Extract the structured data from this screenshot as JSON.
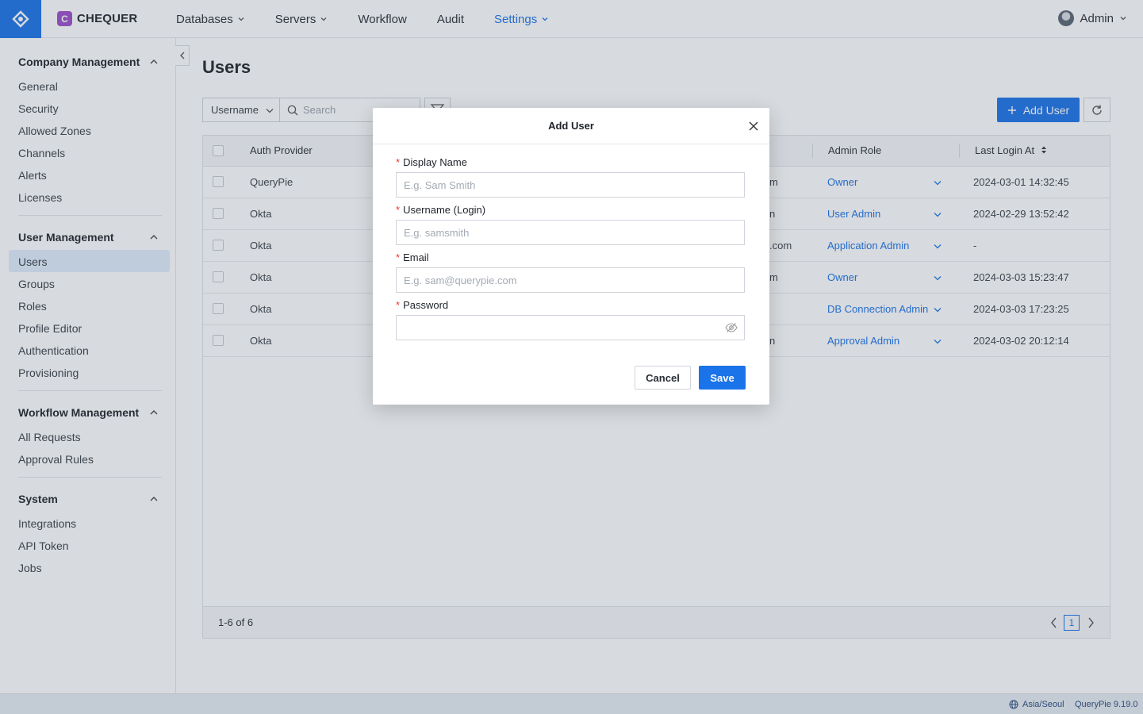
{
  "brand": {
    "name": "CHEQUER",
    "letter": "C"
  },
  "nav": [
    {
      "label": "Databases",
      "has_menu": true
    },
    {
      "label": "Servers",
      "has_menu": true
    },
    {
      "label": "Workflow",
      "has_menu": false
    },
    {
      "label": "Audit",
      "has_menu": false
    },
    {
      "label": "Settings",
      "has_menu": true,
      "active": true
    }
  ],
  "user": {
    "name": "Admin"
  },
  "sidebar": {
    "sections": [
      {
        "title": "Company Management",
        "items": [
          "General",
          "Security",
          "Allowed Zones",
          "Channels",
          "Alerts",
          "Licenses"
        ]
      },
      {
        "title": "User Management",
        "items": [
          "Users",
          "Groups",
          "Roles",
          "Profile Editor",
          "Authentication",
          "Provisioning"
        ]
      },
      {
        "title": "Workflow Management",
        "items": [
          "All Requests",
          "Approval Rules"
        ]
      },
      {
        "title": "System",
        "items": [
          "Integrations",
          "API Token",
          "Jobs"
        ]
      }
    ],
    "active_item": "Users"
  },
  "page": {
    "title": "Users"
  },
  "toolbar": {
    "filter_field": "Username",
    "search_placeholder": "Search",
    "add_label": "Add User"
  },
  "table": {
    "columns": [
      "Auth Provider",
      "Admin Role",
      "Last Login At"
    ],
    "rows": [
      {
        "provider": "QueryPie",
        "partial": "m",
        "role": "Owner",
        "last_login": "2024-03-01 14:32:45"
      },
      {
        "provider": "Okta",
        "partial": "n",
        "role": "User Admin",
        "last_login": "2024-02-29 13:52:42"
      },
      {
        "provider": "Okta",
        "partial": ".com",
        "role": "Application Admin",
        "last_login": "-"
      },
      {
        "provider": "Okta",
        "partial": "m",
        "role": "Owner",
        "last_login": "2024-03-03 15:23:47"
      },
      {
        "provider": "Okta",
        "partial": "",
        "role": "DB Connection Admin",
        "last_login": "2024-03-03 17:23:25"
      },
      {
        "provider": "Okta",
        "partial": "n",
        "role": "Approval Admin",
        "last_login": "2024-03-02 20:12:14"
      }
    ],
    "footer": {
      "count": "1-6 of 6",
      "page": "1"
    }
  },
  "status": {
    "timezone": "Asia/Seoul",
    "version": "QueryPie 9.19.0"
  },
  "modal": {
    "title": "Add User",
    "fields": [
      {
        "label": "Display Name",
        "placeholder": "E.g. Sam Smith"
      },
      {
        "label": "Username (Login)",
        "placeholder": "E.g. samsmith"
      },
      {
        "label": "Email",
        "placeholder": "E.g. sam@querypie.com"
      },
      {
        "label": "Password",
        "placeholder": ""
      }
    ],
    "required_mark": "*",
    "cancel_label": "Cancel",
    "save_label": "Save"
  },
  "colors": {
    "accent": "#1a73e8",
    "brand_badge": "#9b4dca",
    "required": "#e53935"
  }
}
